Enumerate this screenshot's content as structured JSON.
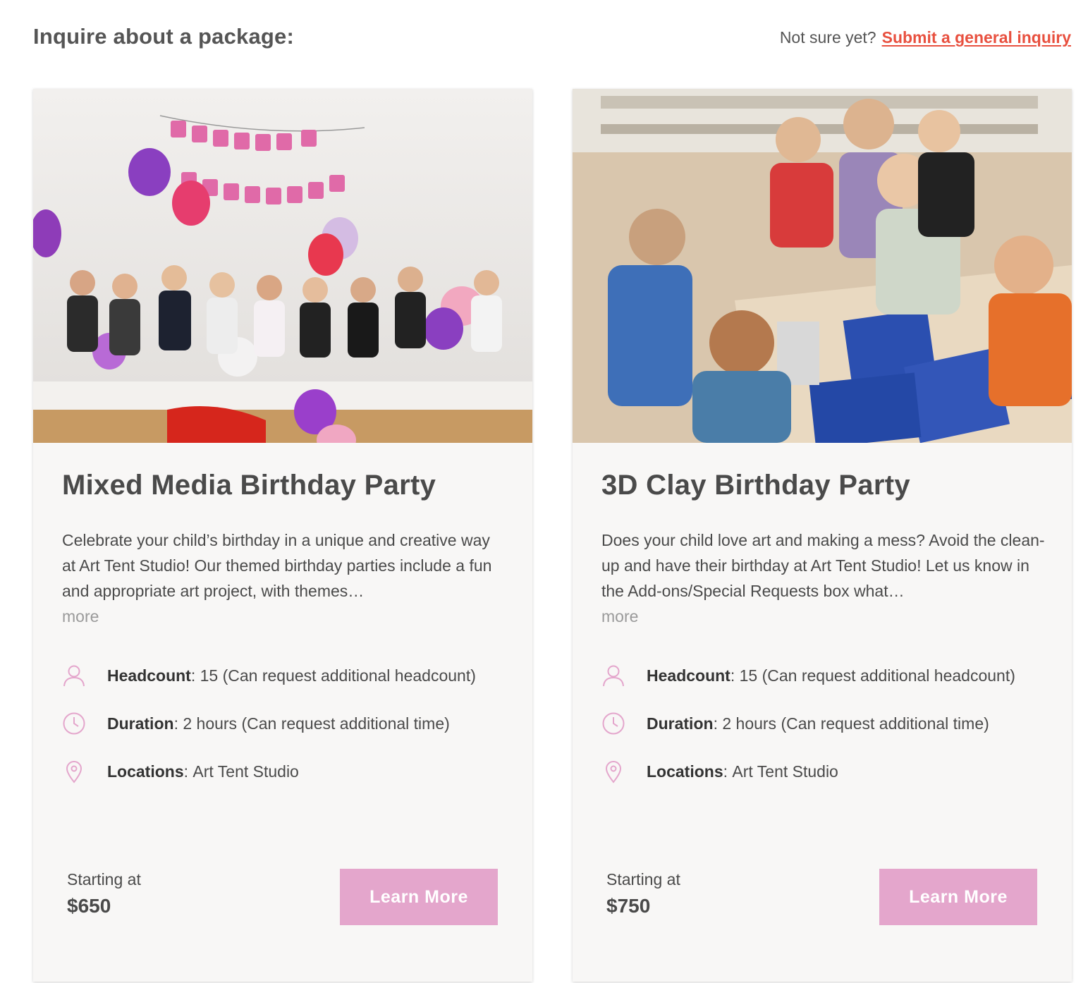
{
  "header": {
    "title": "Inquire about a package:",
    "prompt": "Not sure yet?",
    "link_label": "Submit a general inquiry",
    "link_color": "#e8503f"
  },
  "icons": {
    "headcount": "person-icon",
    "duration": "clock-icon",
    "locations": "map-pin-icon",
    "accent_color": "#e4a6cc"
  },
  "packages": [
    {
      "title": "Mixed Media Birthday Party",
      "description": "Celebrate your child’s birthday in a unique and creative way at Art Tent Studio! Our themed birthday parties include a fun and appropriate art project, with themes…",
      "more_label": "more",
      "headcount_label": "Headcount",
      "headcount_value": "15 (Can request additional headcount)",
      "duration_label": "Duration",
      "duration_value": "2 hours (Can request additional time)",
      "locations_label": "Locations",
      "locations_value": "Art Tent Studio",
      "starting_label": "Starting at",
      "price": "$650",
      "button_label": "Learn More"
    },
    {
      "title": "3D Clay Birthday Party",
      "description": "Does your child love art and making a mess? Avoid the clean-up and have their birthday at Art Tent Studio! Let us know in the Add-ons/Special Requests box what…",
      "more_label": "more",
      "headcount_label": "Headcount",
      "headcount_value": "15 (Can request additional headcount)",
      "duration_label": "Duration",
      "duration_value": "2 hours (Can request additional time)",
      "locations_label": "Locations",
      "locations_value": "Art Tent Studio",
      "starting_label": "Starting at",
      "price": "$750",
      "button_label": "Learn More"
    }
  ]
}
